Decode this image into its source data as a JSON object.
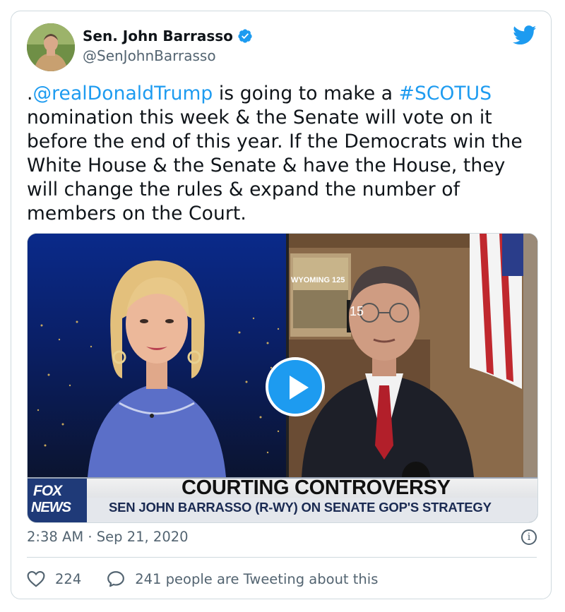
{
  "author": {
    "name": "Sen. John Barrasso",
    "handle": "@SenJohnBarrasso",
    "verified": true
  },
  "tweet": {
    "prefix": ".",
    "mention": "@realDonaldTrump",
    "part1": " is going to make a ",
    "hashtag": "#SCOTUS",
    "part2": " nomination this week & the Senate will vote on it before the end of this year. If the Democrats win the White House & the Senate & have the House, they will change the rules & expand the number of members on the Court."
  },
  "media": {
    "chyron_title": "COURTING CONTROVERSY",
    "chyron_subtitle": "SEN JOHN BARRASSO (R-WY) ON SENATE GOP'S STRATEGY",
    "network_line1": "FOX",
    "network_line2": "NEWS",
    "poster_text": "WYOMING 125",
    "plate_text": "15"
  },
  "timestamp": "2:38 AM · Sep 21, 2020",
  "likes": "224",
  "conversation": "241 people are Tweeting about this",
  "colors": {
    "accent": "#1d9bf0",
    "muted": "#536471"
  },
  "icons": {
    "platform": "twitter-bird-icon",
    "verified": "verified-badge-icon",
    "like": "heart-icon",
    "reply": "speech-bubble-icon",
    "info": "info-icon",
    "play": "play-icon"
  }
}
